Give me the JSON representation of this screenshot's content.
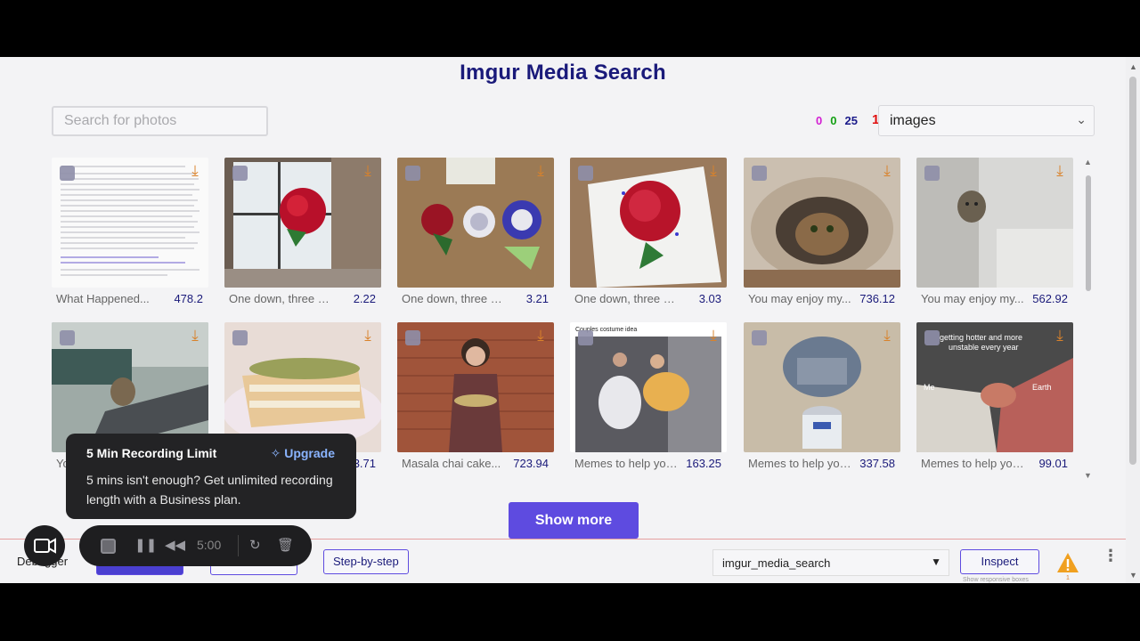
{
  "app": {
    "title": "Imgur Media Search"
  },
  "search": {
    "placeholder": "Search for photos",
    "value": ""
  },
  "counters": {
    "a": "0",
    "b": "0",
    "c": "25",
    "d": "1"
  },
  "media_type": {
    "selected": "images"
  },
  "results": [
    {
      "caption": "What Happened...",
      "size": "478.2"
    },
    {
      "caption": "One down, three to...",
      "size": "2.22"
    },
    {
      "caption": "One down, three to...",
      "size": "3.21"
    },
    {
      "caption": "One down, three to...",
      "size": "3.03"
    },
    {
      "caption": "You may enjoy my...",
      "size": "736.12"
    },
    {
      "caption": "You may enjoy my...",
      "size": "562.92"
    },
    {
      "caption": "Yo",
      "size": ""
    },
    {
      "caption": "",
      "size": "3.71"
    },
    {
      "caption": "Masala chai cake...",
      "size": "723.94"
    },
    {
      "caption": "Memes to help you...",
      "size": "163.25"
    },
    {
      "caption": "Memes to help you...",
      "size": "337.58"
    },
    {
      "caption": "Memes to help you...",
      "size": "99.01"
    }
  ],
  "thumb_text": {
    "meme1_top": "Couples costume idea",
    "meme2_top": "getting hotter and more unstable every year",
    "meme2_left": "Me",
    "meme2_right": "Earth"
  },
  "show_more": {
    "label": "Show more"
  },
  "bottombar": {
    "debugger_label": "Debugger",
    "step_label": "Step-by-step",
    "env_selected": "imgur_media_search",
    "inspect_label": "Inspect",
    "inspect_sub": "Show responsive boxes",
    "warn_count": "1"
  },
  "recording": {
    "tooltip_title": "5 Min Recording Limit",
    "upgrade_label": "Upgrade",
    "tooltip_body": "5 mins isn't enough? Get unlimited recording length with a Business plan.",
    "timer": "5:00"
  },
  "icons": {
    "download": "download-icon",
    "camera": "video-camera-icon",
    "warning": "warning-icon"
  },
  "colors": {
    "accent": "#5e4be0",
    "title": "#1a1a7a",
    "download": "#d9822b"
  }
}
